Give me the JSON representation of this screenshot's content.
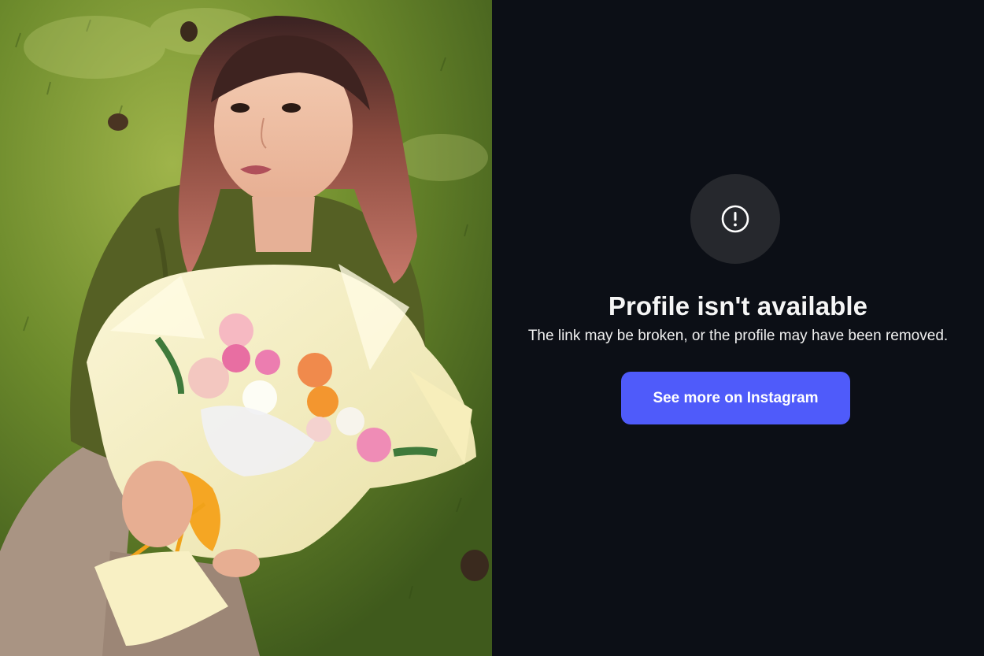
{
  "photo": {
    "description_icon": "portrait-photo"
  },
  "profile": {
    "icon": "alert-circle-icon",
    "title": "Profile isn't available",
    "message": "The link may be broken, or the profile may have been removed.",
    "button_label": "See more on Instagram"
  },
  "colors": {
    "background": "#0c0f16",
    "icon_circle": "#26282d",
    "button": "#4f5bfa",
    "text": "#f5f5f5"
  }
}
